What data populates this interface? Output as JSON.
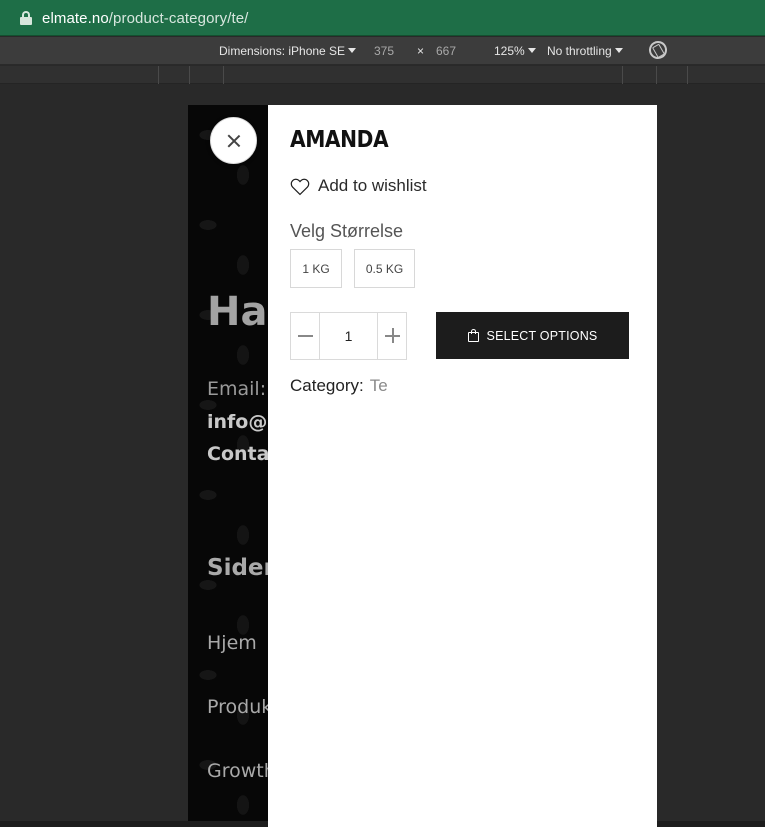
{
  "browser": {
    "url_host": "elmate.no",
    "url_path": "/product-category/te/"
  },
  "devtools": {
    "dimensions_label": "Dimensions: iPhone SE",
    "width": "375",
    "separator": "×",
    "height": "667",
    "zoom": "125%",
    "throttling": "No throttling"
  },
  "background_page": {
    "heading": "Hav",
    "email_label": "Email:",
    "email_value": "info@e",
    "contact": "Contac",
    "sider": "Sider",
    "links": [
      "Hjem",
      "Produk",
      "Growth"
    ]
  },
  "product": {
    "name": "AMANDA",
    "wishlist_label": "Add to wishlist",
    "size_label": "Velg Størrelse",
    "sizes": [
      "1 KG",
      "0.5 KG"
    ],
    "quantity": "1",
    "button_label": "SELECT OPTIONS",
    "category_label": "Category:",
    "category_value": "Te"
  }
}
